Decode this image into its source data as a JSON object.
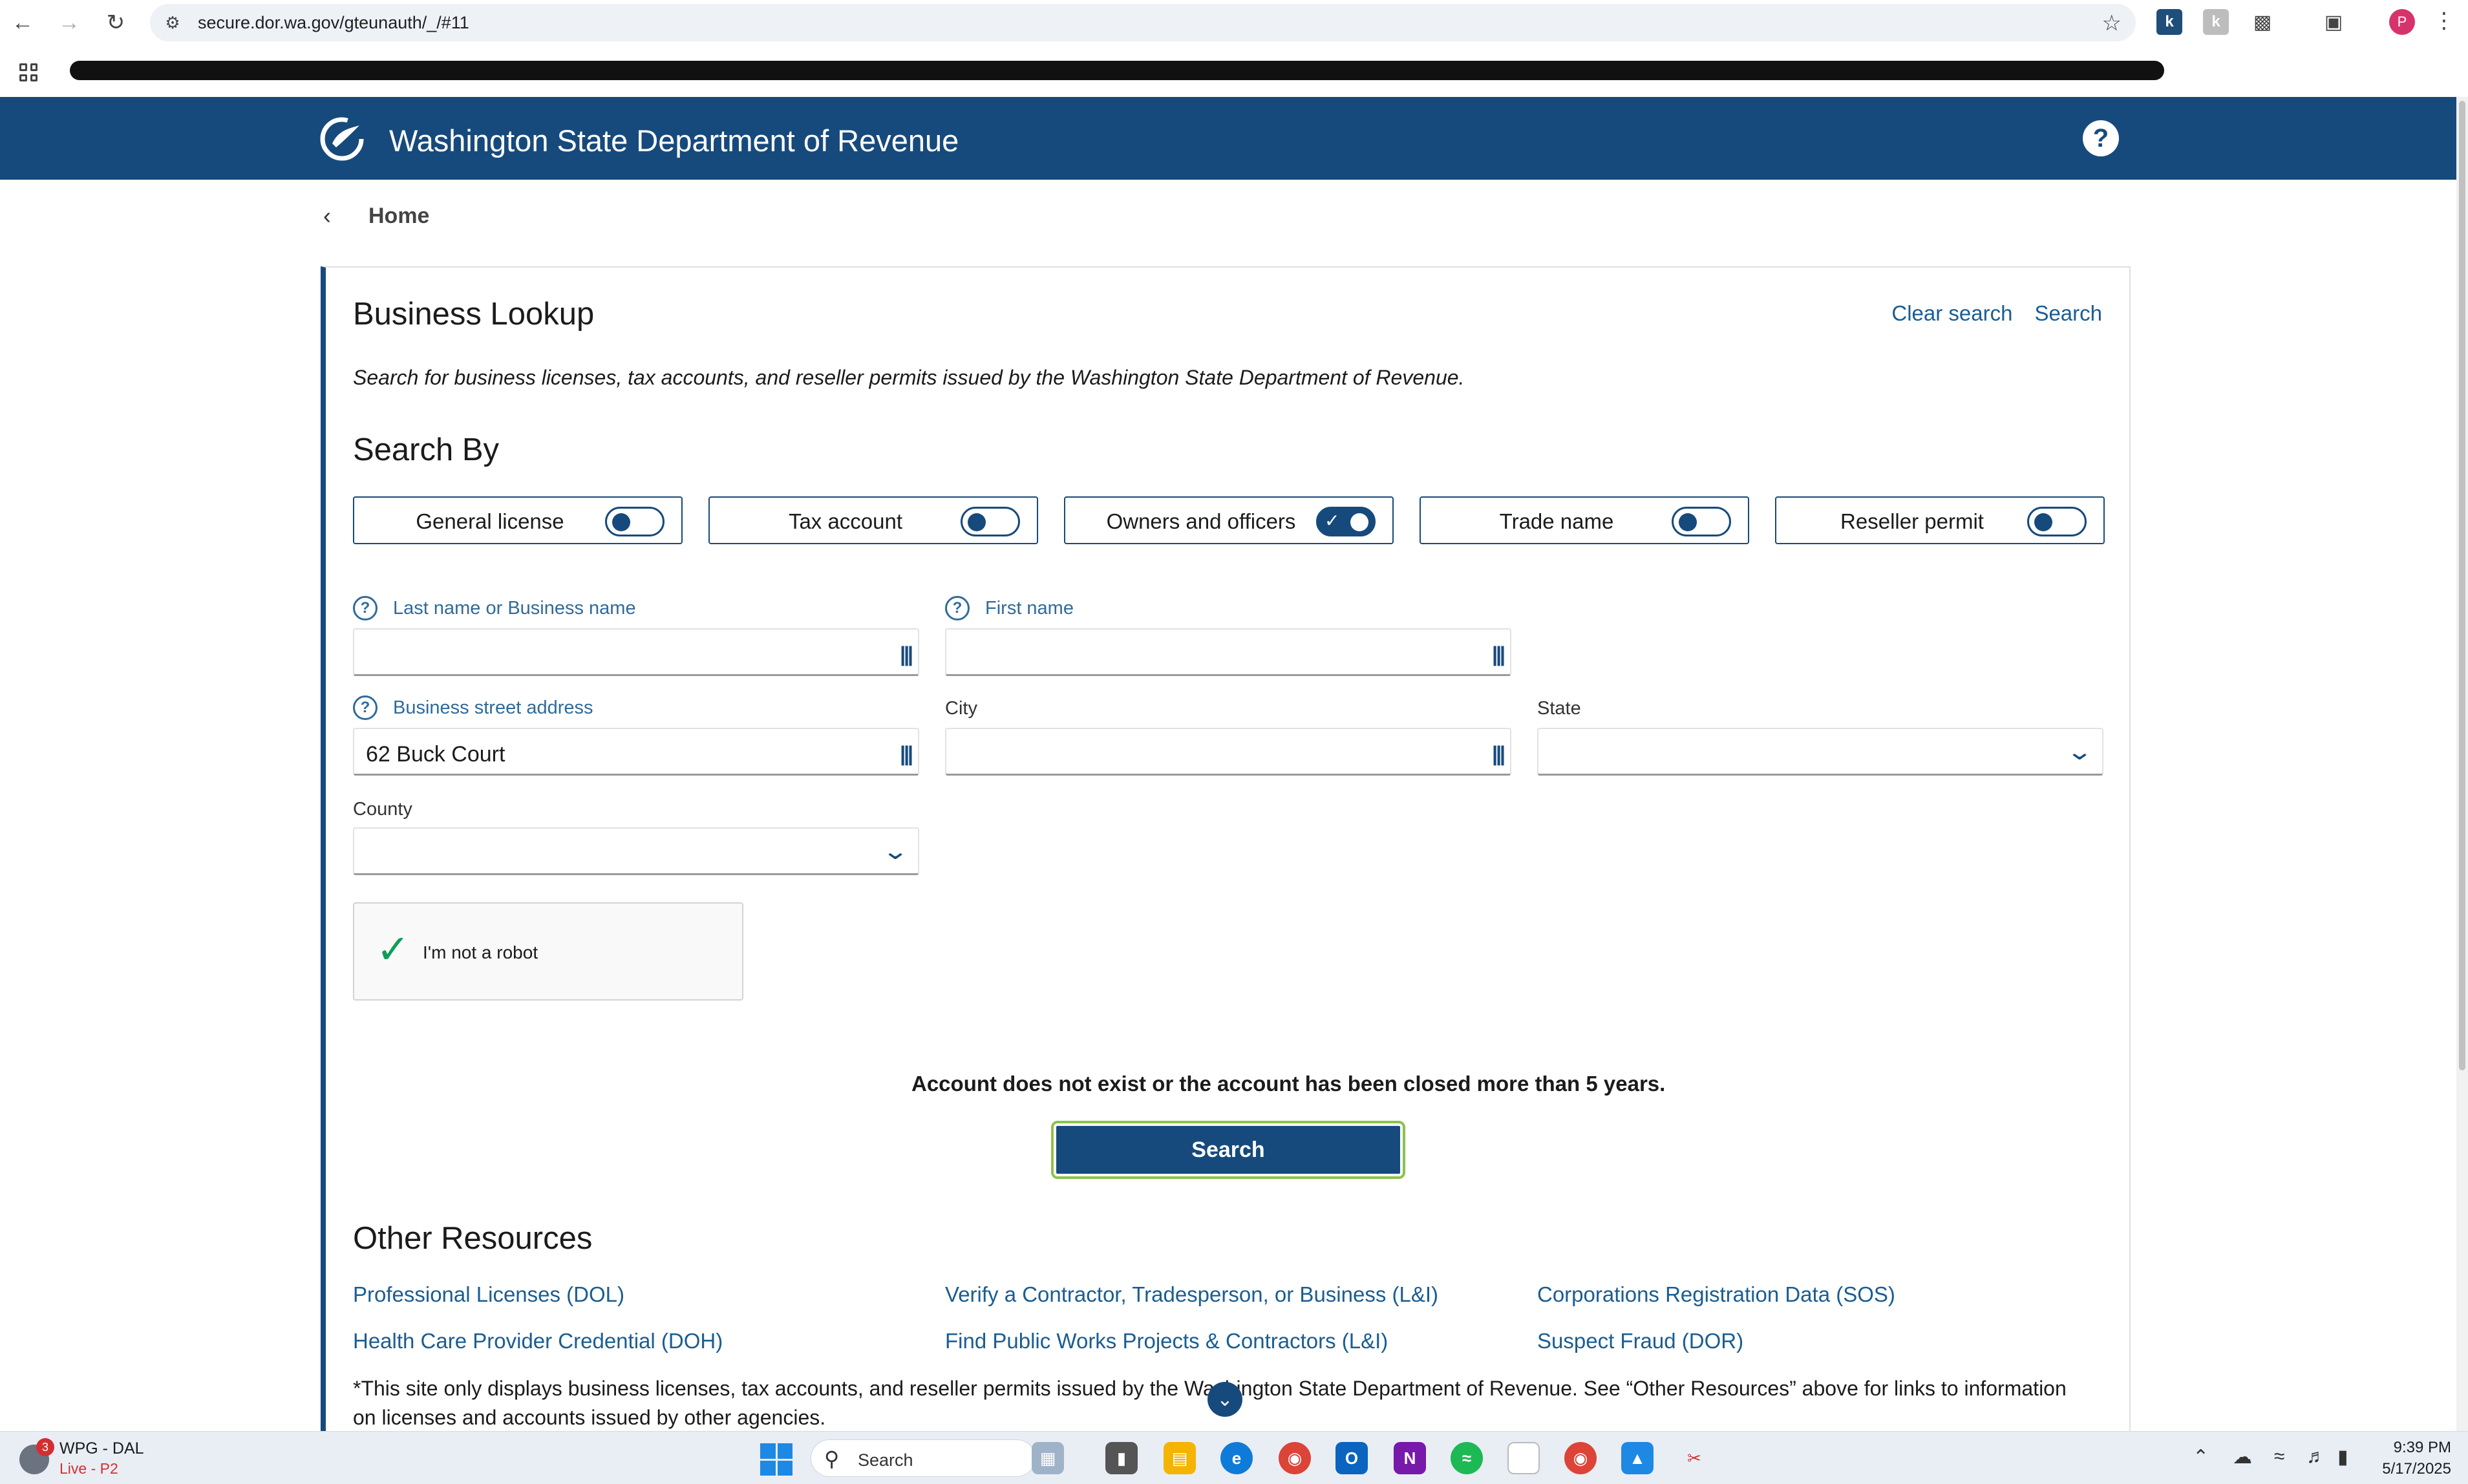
{
  "browser": {
    "url": "secure.dor.wa.gov/gteunauth/_/#11"
  },
  "header": {
    "title": "Washington State Department of Revenue",
    "help_label": "?"
  },
  "breadcrumb": {
    "home": "Home"
  },
  "page": {
    "title": "Business Lookup",
    "clear_search": "Clear search",
    "search_link": "Search",
    "intro": "Search for business licenses, tax accounts, and reseller permits issued by the Washington State Department of Revenue.",
    "search_by": "Search By"
  },
  "toggles": [
    {
      "label": "General license",
      "on": false
    },
    {
      "label": "Tax account",
      "on": false
    },
    {
      "label": "Owners and officers",
      "on": true
    },
    {
      "label": "Trade name",
      "on": false
    },
    {
      "label": "Reseller permit",
      "on": false
    }
  ],
  "fields": {
    "last_name_label": "Last name or Business name",
    "last_name_value": "",
    "first_name_label": "First name",
    "first_name_value": "",
    "street_label": "Business street address",
    "street_value": "62 Buck Court",
    "city_label": "City",
    "city_value": "",
    "state_label": "State",
    "state_value": "",
    "county_label": "County",
    "county_value": ""
  },
  "captcha": {
    "label": "I'm not a robot",
    "checked": true
  },
  "message": "Account does not exist or the account has been closed more than 5 years.",
  "search_button": "Search",
  "other_resources": {
    "title": "Other Resources",
    "links": [
      "Professional Licenses (DOL)",
      "Verify a Contractor, Tradesperson, or Business (L&I)",
      "Corporations Registration Data (SOS)",
      "Health Care Provider Credential (DOH)",
      "Find Public Works Projects & Contractors (L&I)",
      "Suspect Fraud (DOR)"
    ],
    "footnote": "*This site only displays business licenses, tax accounts, and reseller permits issued by the Washington State Department of Revenue. See “Other Resources” above for links to information on licenses and accounts issued by other agencies."
  },
  "taskbar": {
    "weather_badge": "3",
    "widget_title": "WPG - DAL",
    "widget_status": "Live - P2",
    "search_placeholder": "Search",
    "time": "9:39 PM",
    "date": "5/17/2025"
  },
  "colors": {
    "brand": "#174a7c",
    "link": "#1a5d92",
    "focus_outline": "#8bc34a",
    "alert_red": "#d32f2f"
  }
}
